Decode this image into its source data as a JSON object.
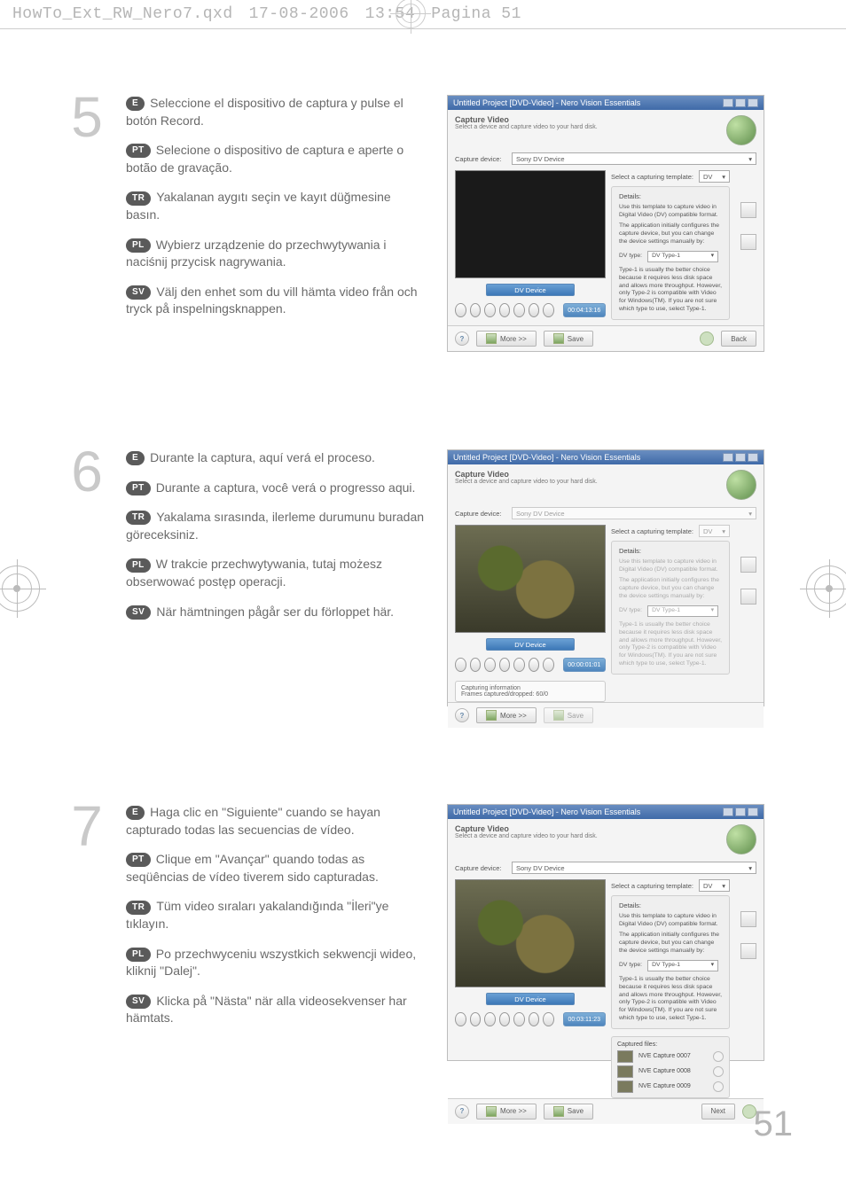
{
  "page_number": "51",
  "header": {
    "filename": "HowTo_Ext_RW_Nero7.qxd",
    "date": "17-08-2006",
    "time": "13:54",
    "page_label": "Pagina 51"
  },
  "steps": [
    {
      "number": "5",
      "langs": {
        "E": "Seleccione el dispositivo de captura y pulse el botón Record.",
        "PT": "Selecione o dispositivo de captura e aperte o botão de gravação.",
        "TR": "Yakalanan aygıtı seçin ve kayıt düğmesine basın.",
        "PL": "Wybierz urządzenie do przechwytywania i naciśnij przycisk nagrywania.",
        "SV": "Välj den enhet som du vill hämta video från och tryck på inspelningsknappen."
      }
    },
    {
      "number": "6",
      "langs": {
        "E": "Durante la captura, aquí verá el proceso.",
        "PT": "Durante a captura, você verá o progresso aqui.",
        "TR": "Yakalama sırasında, ilerleme durumunu buradan göreceksiniz.",
        "PL": "W trakcie przechwytywania, tutaj możesz obserwować postęp operacji.",
        "SV": "När hämtningen pågår ser du förloppet här."
      }
    },
    {
      "number": "7",
      "langs": {
        "E": "Haga clic en \"Siguiente\" cuando se hayan capturado todas las secuencias de vídeo.",
        "PT": "Clique em \"Avançar\" quando todas as seqüências de vídeo tiverem sido capturadas.",
        "TR": "Tüm video sıraları yakalandığında \"İleri\"ye tıklayın.",
        "PL": "Po przechwyceniu wszystkich sekwencji wideo, kliknij \"Dalej\".",
        "SV": "Klicka på \"Nästa\" när alla videosekvenser har hämtats."
      }
    }
  ],
  "screenshot": {
    "window_title": "Untitled Project [DVD-Video] - Nero Vision Essentials",
    "capture_title": "Capture Video",
    "capture_subtitle": "Select a device and capture video to your hard disk.",
    "capture_device_label": "Capture device:",
    "capture_device_value": "Sony DV Device",
    "template_label": "Select a capturing template:",
    "template_value": "DV",
    "details_title": "Details:",
    "details_line1": "Use this template to capture video in Digital Video (DV) compatible format.",
    "details_line2": "The application initially configures the capture device, but you can change the device settings manually by:",
    "dv_type_label": "DV type:",
    "dv_type_value": "DV Type-1",
    "details_line3": "Type-1 is usually the better choice because it requires less disk space and allows more throughput. However, only Type-2 is compatible with Video for Windows(TM). If you are not sure which type to use, select Type-1.",
    "dv_device_label": "DV Device",
    "timecode5": "00:04:13:16",
    "timecode6": "00:00:01:01",
    "timecode7": "00:03:11:23",
    "cap_info_title": "Capturing information",
    "cap_info_line": "Frames captured/dropped: 60/0",
    "captured_files_title": "Captured files:",
    "captured_files": [
      "NVE Capture 0007",
      "NVE Capture 0008",
      "NVE Capture 0009"
    ],
    "btn_more": "More >>",
    "btn_save": "Save",
    "btn_back": "Back",
    "btn_next": "Next"
  }
}
